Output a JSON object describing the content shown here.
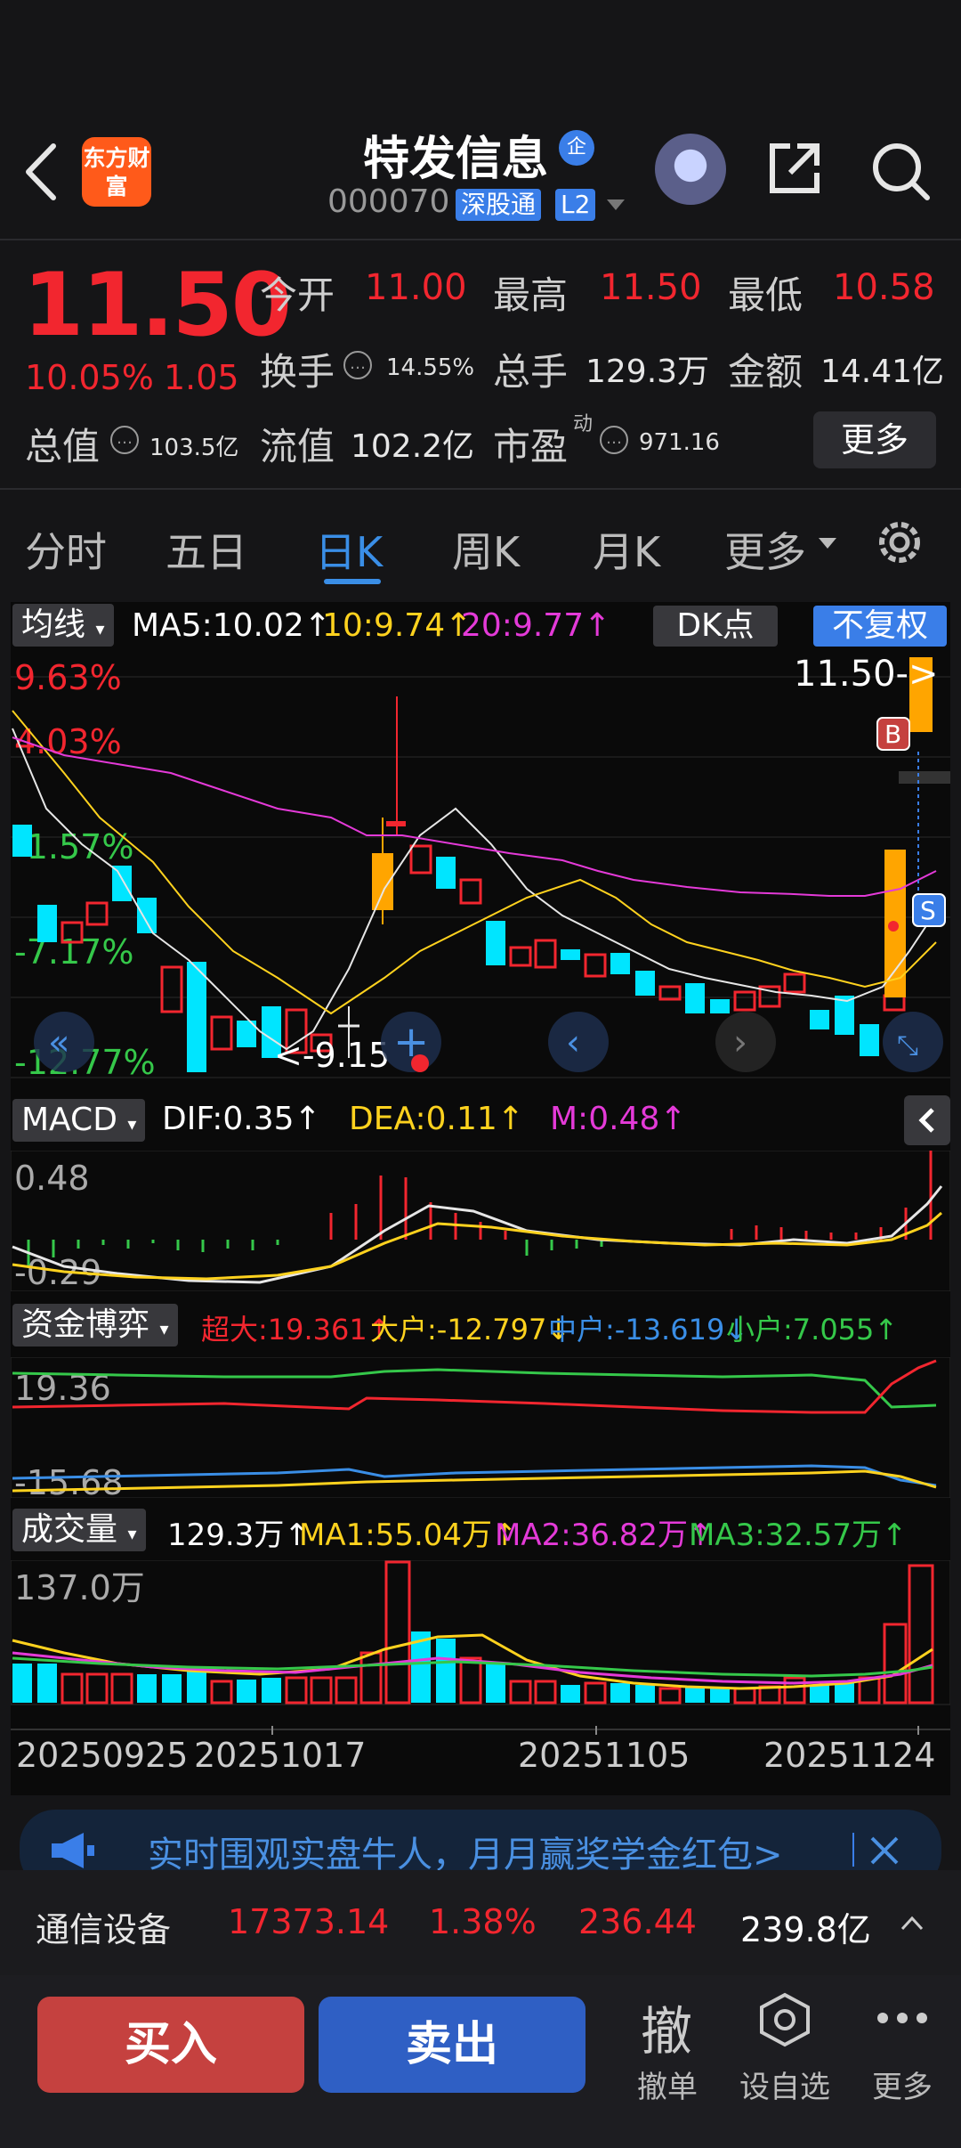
{
  "header": {
    "stock_name": "特发信息",
    "enterprise_badge": "企",
    "stock_code": "000070",
    "connect_badge": "深股通",
    "level_badge": "L2",
    "app_logo": "东方财富"
  },
  "quote": {
    "price": "11.50",
    "change_pct": "10.05%",
    "change": "1.05",
    "open_label": "今开",
    "open": "11.00",
    "high_label": "最高",
    "high": "11.50",
    "low_label": "最低",
    "low": "10.58",
    "turnover_label": "换手",
    "turnover": "14.55%",
    "volume_label": "总手",
    "volume": "129.3万",
    "amount_label": "金额",
    "amount": "14.41亿",
    "mktcap_label": "总值",
    "mktcap": "103.5亿",
    "float_label": "流值",
    "float_value": "102.2亿",
    "pe_label": "市盈",
    "pe_sup": "动",
    "pe": "971.16",
    "more_label": "更多"
  },
  "tabs": [
    {
      "label": "分时"
    },
    {
      "label": "五日"
    },
    {
      "label": "日K"
    },
    {
      "label": "周K"
    },
    {
      "label": "月K"
    },
    {
      "label": "更多"
    }
  ],
  "ma_bar": {
    "tag": "均线",
    "ma5": "MA5:10.02↑",
    "ma10": "10:9.74↑",
    "ma20": "20:9.77↑",
    "dk": "DK点",
    "fq": "不复权"
  },
  "kline": {
    "price_label": "11.50->",
    "low_label": "<-9.15",
    "pct_labels": [
      "9.63%",
      "4.03%",
      "-1.57%",
      "-7.17%",
      "-12.77%"
    ],
    "marker_b": "B",
    "marker_s": "S"
  },
  "macd": {
    "tag": "MACD",
    "dif": "DIF:0.35↑",
    "dea": "DEA:0.11↑",
    "m": "M:0.48↑",
    "top": "0.48",
    "bottom": "-0.29"
  },
  "capital": {
    "tag": "资金博弈",
    "super": "超大:19.361↑",
    "large": "大户:-12.797↓",
    "mid": "中户:-13.619↓",
    "small": "小户:7.055↑",
    "top": "19.36",
    "bottom": "-15.68"
  },
  "volume": {
    "tag": "成交量",
    "vol": "129.3万↑",
    "ma1": "MA1:55.04万↑",
    "ma2": "MA2:36.82万↑",
    "ma3": "MA3:32.57万↑",
    "top": "137.0万"
  },
  "dates": [
    "20250925",
    "20251017",
    "20251105",
    "20251124"
  ],
  "banner": {
    "text": "实时围观实盘牛人，月月赢奖学金红包>"
  },
  "industry": {
    "name": "通信设备",
    "index": "17373.14",
    "pct": "1.38%",
    "change": "236.44",
    "amount": "239.8亿"
  },
  "actions": {
    "buy": "买入",
    "sell": "卖出",
    "cancel_glyph": "撤",
    "cancel": "撤单",
    "watch": "设自选",
    "more": "更多"
  },
  "colors": {
    "up": "#f2262f",
    "down": "#00e5ff",
    "limit": "#ffa500",
    "accent": "#3a8ee6"
  }
}
